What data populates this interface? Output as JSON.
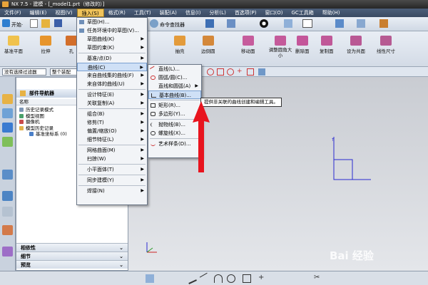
{
  "window": {
    "title": "NX 7.5 - 建模 - [_model1.prt（修改的）]"
  },
  "menubar": {
    "items": [
      "文件(F)",
      "编辑(E)",
      "视图(V)",
      "插入(S)",
      "格式(R)",
      "工具(T)",
      "装配(A)",
      "信息(I)",
      "分析(L)",
      "首选项(P)",
      "窗口(O)",
      "GC工具箱",
      "帮助(H)"
    ]
  },
  "toolbar": {
    "start_label": "开始·",
    "select_filter": "没有选择过滤器",
    "assembly_select": "整个装配",
    "row2_labels": [
      "基准平面",
      "拉伸",
      "孔",
      "抽壳",
      "边倒圆",
      "移动面",
      "调整圆角大小",
      "删除面",
      "复制面",
      "设为共面",
      "线性尺寸"
    ],
    "row1_label_right": "命令查找器"
  },
  "navigator": {
    "title": "部件导航器",
    "column": "名称",
    "tree": [
      "历史记录模式",
      "模型视图",
      "摄像机",
      "模型历史记录",
      "基准坐标系 (0)"
    ],
    "sections": [
      "相依性",
      "细节",
      "预览"
    ]
  },
  "insert_menu": {
    "items": [
      "草图(H)...",
      "任务环境中的草图(V)...",
      "草图曲线(K)",
      "草图约束(K)",
      "基准/点(D)",
      "曲线(C)",
      "来自曲线集的曲线(F)",
      "来自体的曲线(U)",
      "设计特征(E)",
      "关联复制(A)",
      "组合(B)",
      "修剪(T)",
      "偏置/缩放(O)",
      "细节特征(L)",
      "网格曲面(M)",
      "扫掠(W)",
      "小平面体(T)",
      "同步建模(Y)",
      "焊接(N)"
    ]
  },
  "curve_submenu": {
    "items": [
      "直线(L)...",
      "圆弧/圆(C)...",
      "直线和圆弧(A)",
      "基本曲线(B)...",
      "矩形(R)...",
      "多边形(Y)...",
      "抛物线(B)...",
      "螺旋线(X)...",
      "艺术样条(D)..."
    ]
  },
  "tooltip": {
    "text": "提供非关联的曲线创建和编辑工具。"
  },
  "watermark": {
    "text": "Bai 经验"
  },
  "colors": {
    "highlight": "#cfe0f6",
    "arrow": "#e8141e",
    "axis": "#2a2ad0",
    "menu_active": "#f0c35b"
  }
}
